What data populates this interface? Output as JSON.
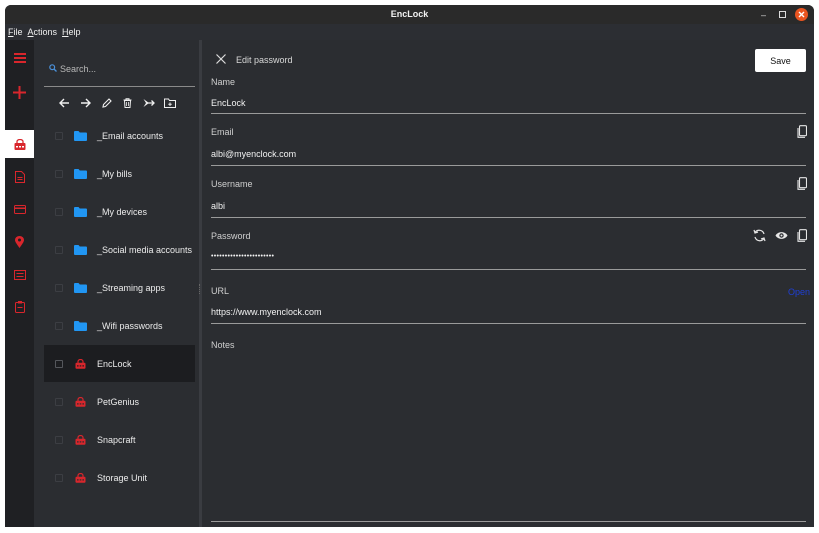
{
  "window": {
    "title": "EncLock"
  },
  "menu": {
    "items": [
      {
        "accel": "F",
        "rest": "ile"
      },
      {
        "accel": "A",
        "rest": "ctions"
      },
      {
        "accel": "H",
        "rest": "elp"
      }
    ]
  },
  "rail": {
    "accent_color": "#d9262c",
    "icons": [
      "menu-icon",
      "add-icon",
      "password-icon",
      "document-icon",
      "card-icon",
      "location-icon",
      "note-icon",
      "clipboard-icon"
    ]
  },
  "search": {
    "placeholder": "Search..."
  },
  "toolbar": {
    "icons": [
      "back-icon",
      "forward-icon",
      "edit-icon",
      "delete-icon",
      "move-icon",
      "new-folder-icon"
    ]
  },
  "list": {
    "folder_color": "#2196f3",
    "item_color": "#d9262c",
    "items": [
      {
        "label": "_Email accounts",
        "type": "folder"
      },
      {
        "label": "_My bills",
        "type": "folder"
      },
      {
        "label": "_My devices",
        "type": "folder"
      },
      {
        "label": "_Social media accounts",
        "type": "folder"
      },
      {
        "label": "_Streaming apps",
        "type": "folder"
      },
      {
        "label": "_Wifi passwords",
        "type": "folder"
      },
      {
        "label": "EncLock",
        "type": "password",
        "selected": true
      },
      {
        "label": "PetGenius",
        "type": "password"
      },
      {
        "label": "Snapcraft",
        "type": "password"
      },
      {
        "label": "Storage Unit",
        "type": "password"
      }
    ]
  },
  "editor": {
    "title": "Edit password",
    "save_label": "Save",
    "fields": {
      "name": {
        "label": "Name",
        "value": "EncLock"
      },
      "email": {
        "label": "Email",
        "value": "albi@myenclock.com"
      },
      "username": {
        "label": "Username",
        "value": "albi"
      },
      "password": {
        "label": "Password",
        "value": "•••••••••••••••••••••••"
      },
      "url": {
        "label": "URL",
        "value": "https://www.myenclock.com",
        "open_label": "Open"
      },
      "notes": {
        "label": "Notes",
        "value": ""
      }
    }
  }
}
